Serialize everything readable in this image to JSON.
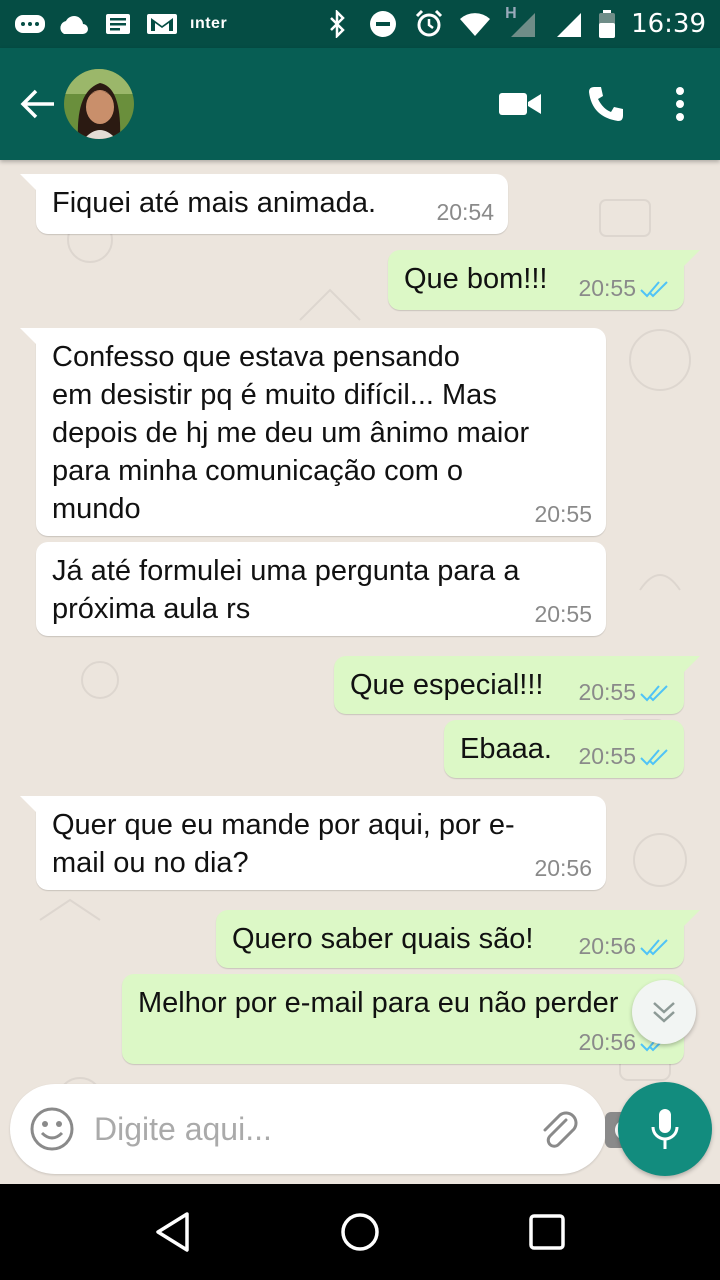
{
  "status_bar": {
    "carrier": "ınter",
    "time": "16:39",
    "network_type": "H"
  },
  "header": {
    "contact_avatar": "contact-avatar-photo"
  },
  "messages": [
    {
      "direction": "in",
      "text": "Fiquei até mais animada.",
      "time": "20:54"
    },
    {
      "direction": "out",
      "text": "Que bom!!!",
      "time": "20:55",
      "status": "read"
    },
    {
      "direction": "in",
      "text": "Confesso que estava pensando\nem desistir pq é muito difícil... Mas\ndepois de hj me deu um ânimo maior\npara minha comunicação com o\nmundo",
      "time": "20:55"
    },
    {
      "direction": "in",
      "text": "Já até formulei uma pergunta para a\npróxima aula rs",
      "time": "20:55"
    },
    {
      "direction": "out",
      "text": "Que especial!!!",
      "time": "20:55",
      "status": "read"
    },
    {
      "direction": "out",
      "text": "Ebaaa.",
      "time": "20:55",
      "status": "read"
    },
    {
      "direction": "in",
      "text": "Quer que eu mande por aqui, por e-\nmail ou no dia?",
      "time": "20:56"
    },
    {
      "direction": "out",
      "text": "Quero saber quais são!",
      "time": "20:56",
      "status": "read"
    },
    {
      "direction": "out",
      "text": "Melhor por e-mail para eu não perder",
      "time": "20:56",
      "status": "read"
    }
  ],
  "composer": {
    "placeholder": "Digite aqui..."
  },
  "colors": {
    "header": "#075e54",
    "status_bar": "#054d44",
    "outgoing_bubble": "#dcf8c6",
    "incoming_bubble": "#ffffff",
    "read_ticks": "#4fc3f7",
    "fab": "#128c7e"
  }
}
